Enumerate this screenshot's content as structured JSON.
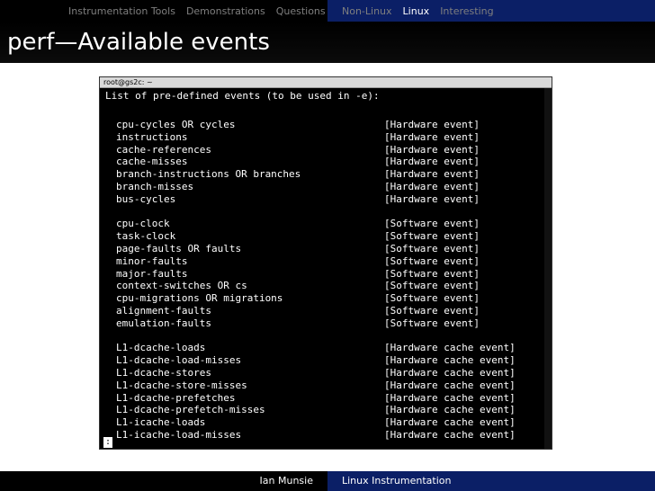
{
  "nav": {
    "left": [
      "Instrumentation Tools",
      "Demonstrations",
      "Questions"
    ],
    "right": [
      "Non-Linux",
      "Linux",
      "Interesting"
    ],
    "active_left": -1,
    "active_right": 1
  },
  "frame_title": "perf—Available events",
  "terminal": {
    "title": "root@gs2c: ~",
    "header": "List of pre-defined events (to be used in -e):",
    "groups": [
      [
        {
          "event": "cpu-cycles OR cycles",
          "type": "[Hardware event]"
        },
        {
          "event": "instructions",
          "type": "[Hardware event]"
        },
        {
          "event": "cache-references",
          "type": "[Hardware event]"
        },
        {
          "event": "cache-misses",
          "type": "[Hardware event]"
        },
        {
          "event": "branch-instructions OR branches",
          "type": "[Hardware event]"
        },
        {
          "event": "branch-misses",
          "type": "[Hardware event]"
        },
        {
          "event": "bus-cycles",
          "type": "[Hardware event]"
        }
      ],
      [
        {
          "event": "cpu-clock",
          "type": "[Software event]"
        },
        {
          "event": "task-clock",
          "type": "[Software event]"
        },
        {
          "event": "page-faults OR faults",
          "type": "[Software event]"
        },
        {
          "event": "minor-faults",
          "type": "[Software event]"
        },
        {
          "event": "major-faults",
          "type": "[Software event]"
        },
        {
          "event": "context-switches OR cs",
          "type": "[Software event]"
        },
        {
          "event": "cpu-migrations OR migrations",
          "type": "[Software event]"
        },
        {
          "event": "alignment-faults",
          "type": "[Software event]"
        },
        {
          "event": "emulation-faults",
          "type": "[Software event]"
        }
      ],
      [
        {
          "event": "L1-dcache-loads",
          "type": "[Hardware cache event]"
        },
        {
          "event": "L1-dcache-load-misses",
          "type": "[Hardware cache event]"
        },
        {
          "event": "L1-dcache-stores",
          "type": "[Hardware cache event]"
        },
        {
          "event": "L1-dcache-store-misses",
          "type": "[Hardware cache event]"
        },
        {
          "event": "L1-dcache-prefetches",
          "type": "[Hardware cache event]"
        },
        {
          "event": "L1-dcache-prefetch-misses",
          "type": "[Hardware cache event]"
        },
        {
          "event": "L1-icache-loads",
          "type": "[Hardware cache event]"
        },
        {
          "event": "L1-icache-load-misses",
          "type": "[Hardware cache event]"
        }
      ]
    ],
    "prompt": ":"
  },
  "footer": {
    "author": "Ian Munsie",
    "title": "Linux Instrumentation"
  }
}
